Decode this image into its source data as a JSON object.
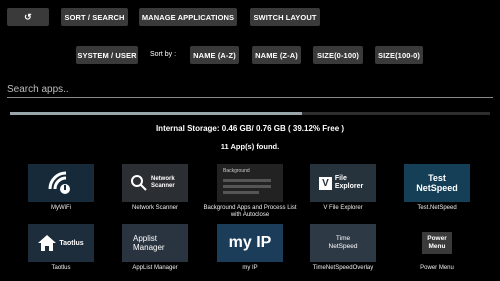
{
  "toolbar": {
    "back_glyph": "↺",
    "sort_search": "SORT / SEARCH",
    "manage_apps": "MANAGE APPLICATIONS",
    "switch_layout": "SWITCH LAYOUT",
    "system_user": "SYSTEM / USER",
    "sort_by_label": "Sort by :",
    "sort_name_az": "NAME (A-Z)",
    "sort_name_za": "NAME (Z-A)",
    "sort_size_asc": "SIZE(0-100)",
    "sort_size_desc": "SIZE(100-0)"
  },
  "search": {
    "placeholder": "Search apps.."
  },
  "storage": {
    "text": "Internal Storage: 0.46 GB/ 0.76 GB ( 39.12% Free )",
    "used_fraction": 0.6088
  },
  "apps_found": "11 App(s) found.",
  "apps": [
    {
      "name": "MyWiFi",
      "icon": "wifi-icon"
    },
    {
      "name": "Network Scanner",
      "icon": "network-scanner-icon",
      "icon_text": "Network Scanner"
    },
    {
      "name": "Background Apps and Process List with Autoclose",
      "icon": "background-apps-icon",
      "icon_text": "Background"
    },
    {
      "name": "V File Explorer",
      "icon": "file-explorer-icon",
      "icon_text": "File Explorer"
    },
    {
      "name": "Test.NetSpeed",
      "icon": "netspeed-icon",
      "icon_text": "Test NetSpeed"
    },
    {
      "name": "Taotlus",
      "icon": "home-icon",
      "icon_text": "Taotlus"
    },
    {
      "name": "AppList Manager",
      "icon": "applist-manager-icon",
      "icon_text": "Applist Manager"
    },
    {
      "name": "my IP",
      "icon": "myip-icon",
      "icon_text": "my IP"
    },
    {
      "name": "TimeNetSpeedOverlay",
      "icon": "time-netspeed-icon",
      "icon_text": "Time NetSpeed"
    },
    {
      "name": "Power Menu",
      "icon": "power-menu-icon",
      "icon_text": "Power Menu"
    }
  ]
}
